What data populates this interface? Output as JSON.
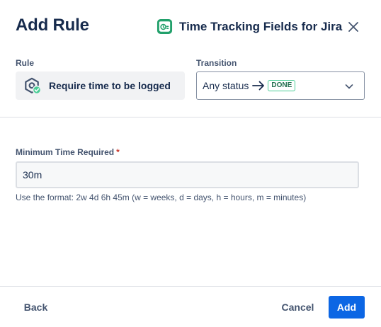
{
  "modal": {
    "title": "Add Rule",
    "app_name": "Time Tracking Fields for Jira",
    "close_icon": "close-icon"
  },
  "rule": {
    "label": "Rule",
    "value": "Require time to be logged",
    "icon": "hexagon-check-icon"
  },
  "transition": {
    "label": "Transition",
    "from": "Any status",
    "arrow_icon": "arrow-right-icon",
    "to_status": "DONE",
    "chevron_icon": "chevron-down-icon"
  },
  "min_time": {
    "label": "Minimum Time Required",
    "required_mark": "*",
    "value": "30m",
    "help": "Use the format: 2w 4d 6h 45m (w = weeks, d = days, h = hours, m = minutes)"
  },
  "footer": {
    "back_label": "Back",
    "cancel_label": "Cancel",
    "add_label": "Add"
  },
  "colors": {
    "primary": "#0c66e4",
    "app_icon_green": "#22a06b",
    "done_green": "#216e4e"
  }
}
